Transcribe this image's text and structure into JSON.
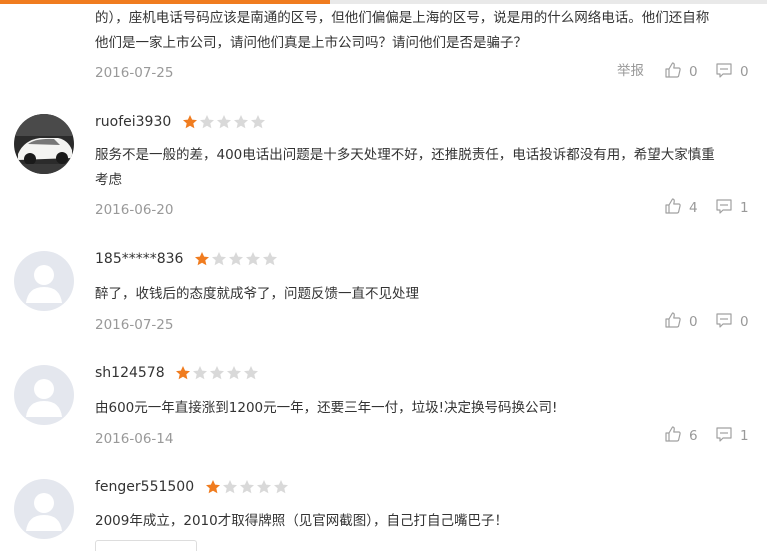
{
  "colors": {
    "accent": "#f07c1f",
    "star_on": "#f07c1f",
    "star_off": "#d9d9d9",
    "topbar_rest": "#e9e9e9"
  },
  "actions": {
    "report_label": "举报"
  },
  "icons": {
    "like": "thumbs-up-icon",
    "comment": "comment-bubble-icon",
    "star": "star-icon"
  },
  "reviews": [
    {
      "content": [
        "的），座机电话号码应该是南通的区号，但他们偏偏是上海的区号，说是用的什么网络电话。他们还自称",
        "他们是一家上市公司，请问他们真是上市公司吗？请问他们是否是骗子？"
      ],
      "date": "2016-07-25",
      "likes": "0",
      "comments": "0"
    },
    {
      "user": "ruofei3930",
      "rating": 1,
      "avatar": "car-photo",
      "content": [
        "服务不是一般的差，400电话出问题是十多天处理不好，还推脱责任，电话投诉都没有用，希望大家慎重",
        "考虑"
      ],
      "date": "2016-06-20",
      "likes": "4",
      "comments": "1"
    },
    {
      "user": "185*****836",
      "rating": 1,
      "avatar": "default",
      "content": [
        "醉了，收钱后的态度就成爷了，问题反馈一直不见处理"
      ],
      "date": "2016-07-25",
      "likes": "0",
      "comments": "0"
    },
    {
      "user": "sh124578",
      "rating": 1,
      "avatar": "default",
      "content": [
        "由600元一年直接涨到1200元一年，还要三年一付，垃圾!决定换号码换公司!"
      ],
      "date": "2016-06-14",
      "likes": "6",
      "comments": "1"
    },
    {
      "user": "fenger551500",
      "rating": 1,
      "avatar": "default",
      "content": [
        "2009年成立，2010才取得牌照（见官网截图），自己打自己嘴巴子！"
      ]
    }
  ]
}
